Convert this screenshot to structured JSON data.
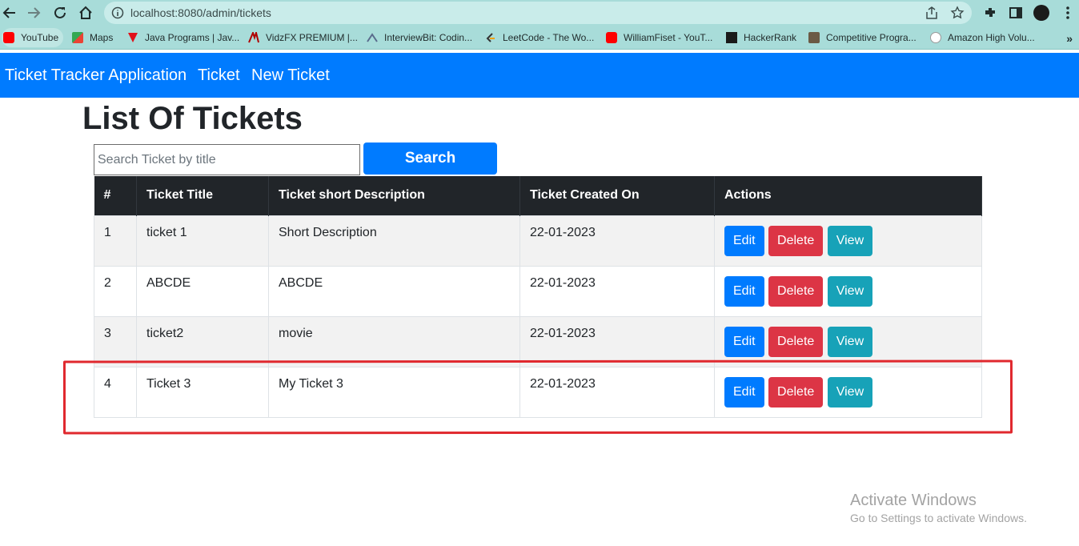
{
  "browser": {
    "url": "localhost:8080/admin/tickets",
    "bookmarks": [
      {
        "label": "YouTube",
        "icon": "youtube-icon"
      },
      {
        "label": "Maps",
        "icon": "maps-icon"
      },
      {
        "label": "Java Programs | Jav...",
        "icon": "java-programs-icon"
      },
      {
        "label": "VidzFX PREMIUM |...",
        "icon": "vidzfx-icon"
      },
      {
        "label": "InterviewBit: Codin...",
        "icon": "interviewbit-icon"
      },
      {
        "label": "LeetCode - The Wo...",
        "icon": "leetcode-icon"
      },
      {
        "label": "WilliamFiset - YouT...",
        "icon": "youtube-icon"
      },
      {
        "label": "HackerRank",
        "icon": "hackerrank-icon"
      },
      {
        "label": "Competitive Progra...",
        "icon": "competitive-programming-icon"
      },
      {
        "label": "Amazon High Volu...",
        "icon": "amazon-icon"
      }
    ],
    "overflow": "»"
  },
  "navbar": {
    "brand": "Ticket Tracker Application",
    "links": [
      "Ticket",
      "New Ticket"
    ],
    "color": "#007bff"
  },
  "page": {
    "title": "List Of Tickets"
  },
  "search": {
    "placeholder": "Search Ticket by title",
    "value": "",
    "button_label": "Search"
  },
  "table": {
    "headers": [
      "#",
      "Ticket Title",
      "Ticket short Description",
      "Ticket Created On",
      "Actions"
    ],
    "rows": [
      {
        "id": "1",
        "title": "ticket 1",
        "description": "Short Description",
        "created": "22-01-2023"
      },
      {
        "id": "2",
        "title": "ABCDE",
        "description": "ABCDE",
        "created": "22-01-2023"
      },
      {
        "id": "3",
        "title": "ticket2",
        "description": "movie",
        "created": "22-01-2023"
      },
      {
        "id": "4",
        "title": "Ticket 3",
        "description": "My Ticket 3",
        "created": "22-01-2023"
      }
    ],
    "actions": {
      "edit": "Edit",
      "delete": "Delete",
      "view": "View"
    }
  },
  "colors": {
    "edit": "#007bff",
    "delete": "#dc3545",
    "view": "#17a2b8",
    "highlight": "#e0282e"
  },
  "watermark": {
    "line1": "Activate Windows",
    "line2": "Go to Settings to activate Windows."
  }
}
